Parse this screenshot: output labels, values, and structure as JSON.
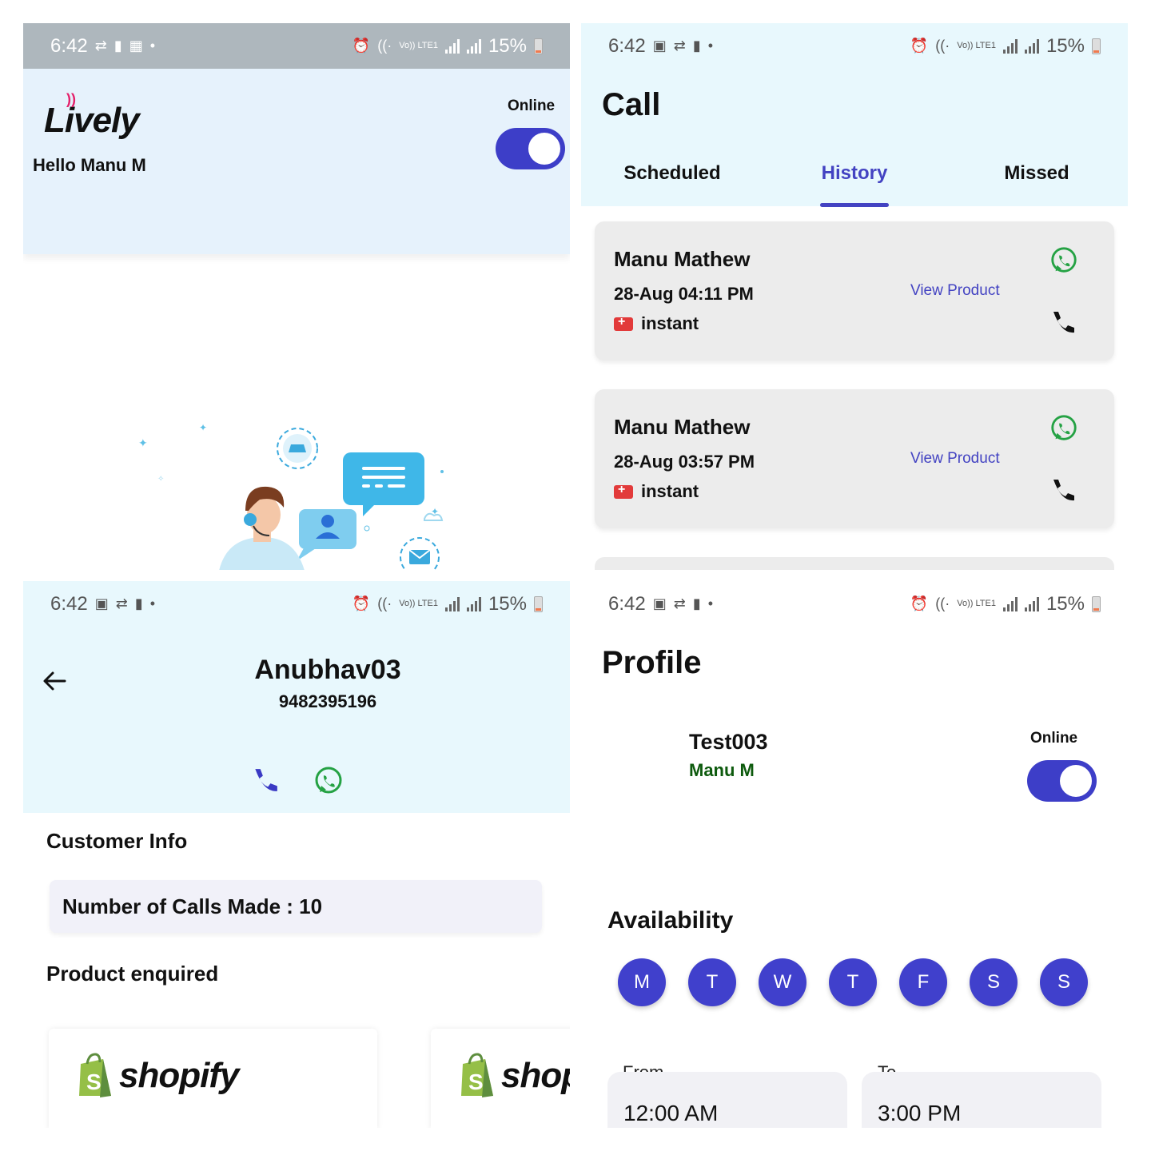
{
  "status": {
    "time": "6:42",
    "battery": "15%",
    "volte": "Vo)) LTE1"
  },
  "home": {
    "brand": "Lively",
    "greeting": "Hello Manu M",
    "online_label": "Online",
    "online": true
  },
  "call": {
    "title": "Call",
    "tabs": [
      {
        "label": "Scheduled",
        "active": false
      },
      {
        "label": "History",
        "active": true
      },
      {
        "label": "Missed",
        "active": false
      }
    ],
    "history": [
      {
        "name": "Manu Mathew",
        "time": "28-Aug 04:11 PM",
        "type": "instant",
        "link": "View Product"
      },
      {
        "name": "Manu Mathew",
        "time": "28-Aug 03:57 PM",
        "type": "instant",
        "link": "View Product"
      }
    ]
  },
  "customer": {
    "name": "Anubhav03",
    "phone": "9482395196",
    "info_label": "Customer Info",
    "calls_made": "Number of Calls Made : 10",
    "product_label": "Product enquired",
    "products": [
      {
        "brand": "shopify"
      },
      {
        "brand": "shop"
      }
    ]
  },
  "profile": {
    "title": "Profile",
    "username": "Test003",
    "display_name": "Manu M",
    "online_label": "Online",
    "online": true,
    "availability_label": "Availability",
    "days": [
      "M",
      "T",
      "W",
      "T",
      "F",
      "S",
      "S"
    ],
    "from_label": "From",
    "from_value": "12:00 AM",
    "to_label": "To",
    "to_value": "3:00 PM"
  },
  "colors": {
    "accent": "#4343c2",
    "whatsapp": "#25a244",
    "brand_red": "#e4206a",
    "header_bg": "#e8f8fd"
  }
}
